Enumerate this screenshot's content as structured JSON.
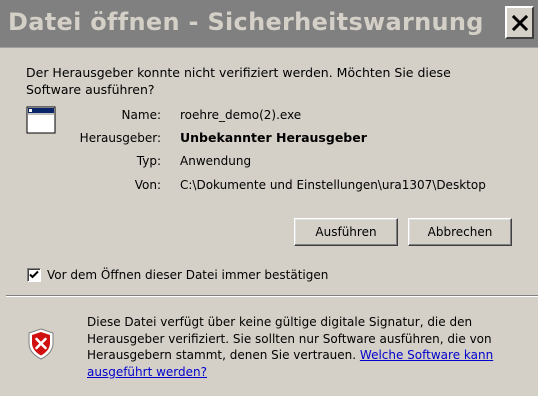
{
  "dialog": {
    "title": "Datei öffnen - Sicherheitswarnung",
    "question": "Der Herausgeber konnte nicht verifiziert werden. Möchten Sie diese Software ausführen?"
  },
  "file_info": {
    "name_label": "Name:",
    "name_value": "roehre_demo(2).exe",
    "publisher_label": "Herausgeber:",
    "publisher_value": "Unbekannter Herausgeber",
    "type_label": "Typ:",
    "type_value": "Anwendung",
    "from_label": "Von:",
    "from_value": "C:\\Dokumente und Einstellungen\\ura1307\\Desktop"
  },
  "buttons": {
    "run": "Ausführen",
    "cancel": "Abbrechen"
  },
  "confirm_checkbox": {
    "label": "Vor dem Öffnen dieser Datei immer bestätigen",
    "checked": true
  },
  "warning": {
    "text": "Diese Datei verfügt über keine gültige digitale Signatur, die den Herausgeber verifiziert. Sie sollten nur Software ausführen, die von Herausgebern stammt, denen Sie vertrauen. ",
    "link": "Welche Software kann ausgeführt werden?"
  },
  "icons": {
    "close": "close-icon",
    "app": "application-window-icon",
    "check": "checkmark-icon",
    "shield": "security-shield-error-icon"
  },
  "colors": {
    "dialog_bg": "#d4d0c8",
    "titlebar_bg": "#808080",
    "link": "#0000cc",
    "shield_red": "#d01010"
  }
}
